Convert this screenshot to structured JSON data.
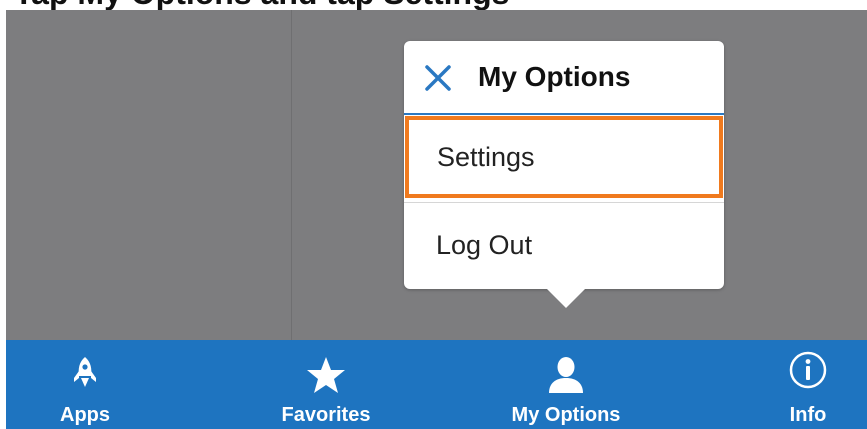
{
  "caption": {
    "text": "Tap My Options and tap Settings"
  },
  "popover": {
    "title": "My Options",
    "close_icon": "close-icon",
    "items": [
      {
        "label": "Settings",
        "selected": true
      },
      {
        "label": "Log Out",
        "selected": false
      }
    ]
  },
  "tab_bar": {
    "tabs": [
      {
        "label": "Apps",
        "icon": "rocket-icon"
      },
      {
        "label": "Favorites",
        "icon": "star-icon"
      },
      {
        "label": "My Options",
        "icon": "user-icon"
      },
      {
        "label": "Info",
        "icon": "info-icon"
      }
    ]
  },
  "colors": {
    "accent": "#1e74c0",
    "highlight": "#f07a1e",
    "backdrop": "#7d7d7f"
  }
}
